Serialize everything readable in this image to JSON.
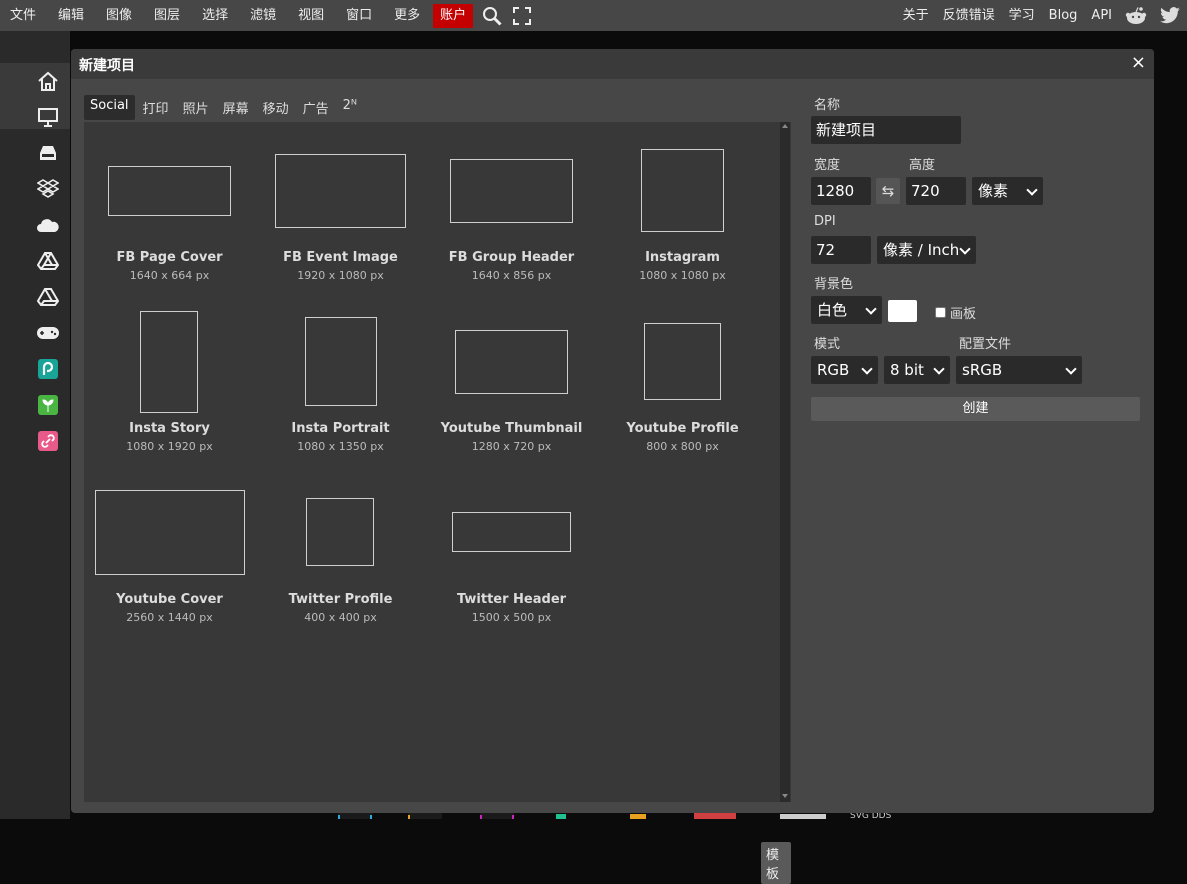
{
  "menu": {
    "items": [
      "文件",
      "编辑",
      "图像",
      "图层",
      "选择",
      "滤镜",
      "视图",
      "窗口",
      "更多"
    ],
    "account": "账户",
    "right_items": [
      "关于",
      "反馈错误",
      "学习",
      "Blog",
      "API"
    ],
    "icons": [
      "search-icon",
      "fullscreen-icon",
      "reddit-icon",
      "twitter-icon"
    ],
    "accent": "#c40000"
  },
  "sidebar": {
    "icons": [
      "home-icon",
      "monitor-icon",
      "storage-icon",
      "dropbox-icon",
      "onedrive-icon",
      "google-drive-icon",
      "google-drive-alt-icon",
      "gamepad-icon",
      "photopea-icon",
      "vectr-icon",
      "link-icon"
    ]
  },
  "dialog": {
    "title": "新建项目",
    "close": "×",
    "tabs": [
      "Social",
      "打印",
      "照片",
      "屏幕",
      "移动",
      "广告",
      "2ᴺ"
    ],
    "templates_button": "模板",
    "templates": [
      {
        "name": "FB Page Cover",
        "size": "1640 x 664 px"
      },
      {
        "name": "FB Event Image",
        "size": "1920 x 1080 px"
      },
      {
        "name": "FB Group Header",
        "size": "1640 x 856 px"
      },
      {
        "name": "Instagram",
        "size": "1080 x 1080 px"
      },
      {
        "name": "Insta Story",
        "size": "1080 x 1920 px"
      },
      {
        "name": "Insta Portrait",
        "size": "1080 x 1350 px"
      },
      {
        "name": "Youtube Thumbnail",
        "size": "1280 x 720 px"
      },
      {
        "name": "Youtube Profile",
        "size": "800 x 800 px"
      },
      {
        "name": "Youtube Cover",
        "size": "2560 x 1440 px"
      },
      {
        "name": "Twitter Profile",
        "size": "400 x 400 px"
      },
      {
        "name": "Twitter Header",
        "size": "1500 x 500 px"
      }
    ],
    "form": {
      "name_label": "名称",
      "name_value": "新建项目",
      "width_label": "宽度",
      "width_value": "1280",
      "height_label": "高度",
      "height_value": "720",
      "unit_value": "像素",
      "dpi_label": "DPI",
      "dpi_value": "72",
      "dpi_unit_value": "像素 / Inch",
      "bg_label": "背景色",
      "bg_value": "白色",
      "bg_color": "#ffffff",
      "canvas_label": "画板",
      "mode_label": "模式",
      "mode_value": "RGB",
      "bits_value": "8 bit",
      "profile_label": "配置文件",
      "profile_value": "sRGB",
      "create_label": "创建"
    }
  }
}
